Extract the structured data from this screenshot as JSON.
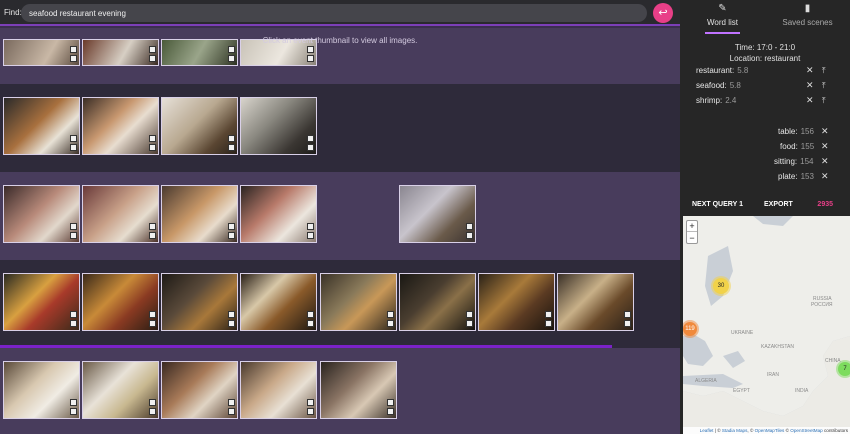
{
  "search": {
    "label": "Find:",
    "value": "seafood restaurant evening",
    "submit_icon": "return-arrow-icon"
  },
  "gallery": {
    "hint": "Click an event thumbnail to view all images."
  },
  "panel": {
    "tabs": [
      {
        "label": "Word list",
        "icon": "pencil-icon",
        "active": true
      },
      {
        "label": "Saved scenes",
        "icon": "bookmark-icon",
        "active": false
      }
    ],
    "time": "Time: 17:0 - 21:0",
    "location": "Location: restaurant",
    "query_words": [
      {
        "word": "restaurant:",
        "score": "5.8"
      },
      {
        "word": "seafood:",
        "score": "5.8"
      },
      {
        "word": "shrimp:",
        "score": "2.4"
      }
    ],
    "context_words": [
      {
        "word": "table:",
        "score": "156"
      },
      {
        "word": "food:",
        "score": "155"
      },
      {
        "word": "sitting:",
        "score": "154"
      },
      {
        "word": "plate:",
        "score": "153"
      }
    ],
    "actions": {
      "next_query": "NEXT QUERY 1",
      "export": "EXPORT",
      "total": "2935"
    }
  },
  "map": {
    "zoom_in": "+",
    "zoom_out": "−",
    "clusters": [
      {
        "count": "30",
        "color": "#f1d24a"
      },
      {
        "count": "119",
        "color": "#f08a3c"
      },
      {
        "count": "7",
        "color": "#7ddc5e"
      }
    ],
    "labels": [
      "RUSSIA",
      "РОССИЯ",
      "UKRAINE",
      "KAZAKHSTAN",
      "ALGERIA",
      "EGYPT",
      "CHINA",
      "IRAN",
      "INDIA"
    ],
    "attribution": {
      "leaflet": "Leaflet",
      "sep1": " | © ",
      "stadia": "Stadia Maps",
      "sep2": ", © ",
      "omt": "OpenMapTiles",
      "sep3": " © ",
      "osm": "OpenStreetMap",
      "sep4": " contributors"
    }
  },
  "colors": {
    "accent": "#7c3fb8",
    "pink": "#e83f88",
    "row_dark": "#2e2a3a",
    "row_light": "#483c5c"
  }
}
